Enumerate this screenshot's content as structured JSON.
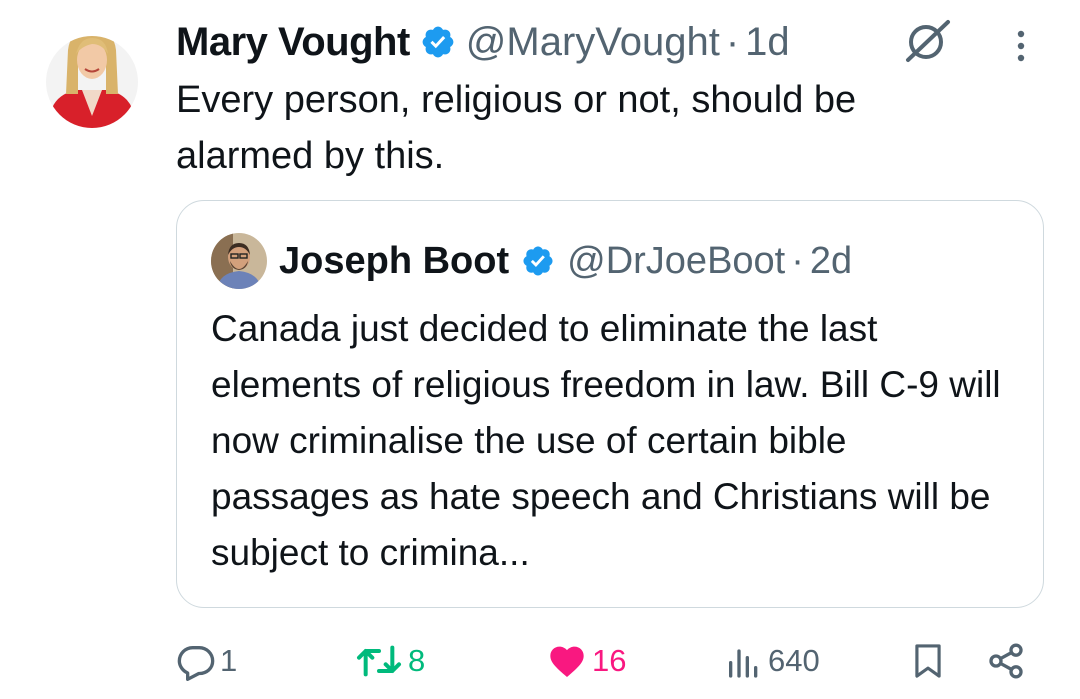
{
  "tweet": {
    "author_name": "Mary Vought",
    "handle": "@MaryVought",
    "separator": "·",
    "age": "1d",
    "text": "Every person, religious or not, should be alarmed by this."
  },
  "quoted_tweet": {
    "author_name": "Joseph Boot",
    "handle": "@DrJoeBoot",
    "separator": "·",
    "age": "2d",
    "text": "Canada just decided to eliminate the last elements of religious freedom in law. Bill C-9 will now criminalise the use of certain bible passages as hate speech and Christians will be subject to crimina..."
  },
  "actions": {
    "replies": "1",
    "reposts": "8",
    "likes": "16",
    "views": "640"
  },
  "colors": {
    "verified": "#1d9bf0",
    "repost": "#00ba7c",
    "like": "#f91880",
    "secondary_text": "#536471",
    "border": "#cfd9de"
  },
  "icons": [
    "verified-badge-icon",
    "grok-icon",
    "more-options-icon",
    "reply-icon",
    "repost-icon",
    "like-heart-icon",
    "views-icon",
    "bookmark-icon",
    "share-icon"
  ]
}
